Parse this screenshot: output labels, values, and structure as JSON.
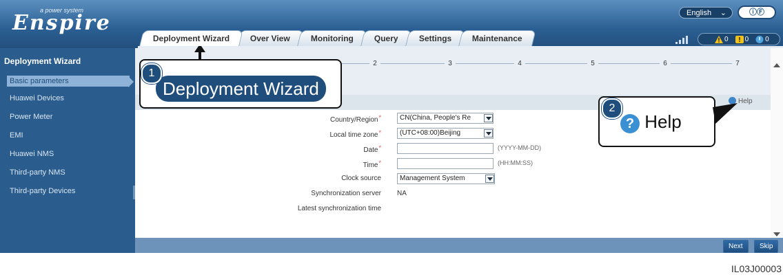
{
  "header": {
    "logo_tag": "a power system",
    "logo_name": "Enspire",
    "tabs": [
      "Deployment Wizard",
      "Over View",
      "Monitoring",
      "Query",
      "Settings",
      "Maintenance"
    ],
    "language": "English",
    "user_button": "ⓘⒻ",
    "alarms": {
      "critical": "0",
      "major": "0",
      "minor": "0"
    }
  },
  "sidebar": {
    "title": "Deployment Wizard",
    "items": [
      "Basic parameters",
      "Huawei Devices",
      "Power Meter",
      "EMI",
      "Huawei NMS",
      "Third-party NMS",
      "Third-party Devices"
    ]
  },
  "wizard": {
    "steps": [
      "2",
      "3",
      "4",
      "5",
      "6",
      "7"
    ],
    "help_label": "Help"
  },
  "form": {
    "country_label": "Country/Region",
    "country_value": "CN(China, People's Re",
    "timezone_label": "Local time zone",
    "timezone_value": "(UTC+08:00)Beijing",
    "date_label": "Date",
    "date_value": "",
    "date_hint": "(YYYY-MM-DD)",
    "time_label": "Time",
    "time_value": "",
    "time_hint": "(HH:MM:SS)",
    "clock_label": "Clock source",
    "clock_value": "Management System",
    "sync_label": "Synchronization server",
    "sync_value": "NA",
    "latest_label": "Latest synchronization time",
    "latest_value": ""
  },
  "footer": {
    "next": "Next",
    "skip": "Skip"
  },
  "callouts": {
    "one_number": "1",
    "one_text": "Deployment Wizard",
    "two_number": "2",
    "two_text": "Help",
    "help_glyph": "?"
  },
  "figure_code": "IL03J00003",
  "colors": {
    "header": "#2b5f93",
    "sidebar": "#2a5c8e",
    "accent": "#1f4d7c",
    "help_icon": "#3b8fd3"
  }
}
